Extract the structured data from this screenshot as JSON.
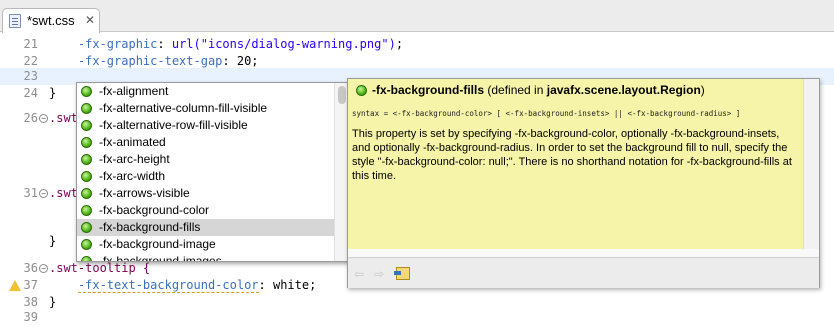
{
  "tab": {
    "title": "*swt.css",
    "close_glyph": "✕",
    "icon": "css-file-icon"
  },
  "editor": {
    "lines": [
      {
        "num": "21",
        "indent": "    ",
        "prop": "-fx-graphic",
        "rest": ": ",
        "str": "url(\"icons/dialog-warning.png\")",
        "tail": ";"
      },
      {
        "num": "22",
        "indent": "    ",
        "prop": "-fx-graphic-text-gap",
        "rest": ": 20;"
      },
      {
        "num": "23",
        "text": ""
      },
      {
        "num": "24",
        "text": "}"
      },
      {
        "num": "26",
        "text": ".swt"
      },
      {
        "num": "31",
        "text": ".swt"
      },
      {
        "num": "",
        "text": "}"
      },
      {
        "num": "36",
        "text": ".swt-tooltip {"
      },
      {
        "num": "37",
        "indent": "    ",
        "prop": "-fx-text-background-color",
        "rest": ": white;"
      },
      {
        "num": "38",
        "text": "}"
      },
      {
        "num": "39",
        "text": ""
      }
    ],
    "fold_glyph": "−"
  },
  "completion": {
    "items": [
      "-fx-alignment",
      "-fx-alternative-column-fill-visible",
      "-fx-alternative-row-fill-visible",
      "-fx-animated",
      "-fx-arc-height",
      "-fx-arc-width",
      "-fx-arrows-visible",
      "-fx-background-color",
      "-fx-background-fills",
      "-fx-background-image",
      "-fx-background-images"
    ],
    "selected_index": 8
  },
  "info": {
    "name": "-fx-background-fills",
    "defined_prefix": "(defined in ",
    "defined_class": "javafx.scene.layout.Region",
    "defined_suffix": ")",
    "syntax": "syntax = <-fx-background-color> [ <-fx-background-insets> || <-fx-background-radius> ]",
    "description": "This property is set by specifying -fx-background-color, optionally -fx-background-insets, and optionally -fx-background-radius. In order to set the background fill to null, specify the style \"-fx-background-color: null;\". There is no shorthand notation for -fx-background-fills at this time.",
    "back_glyph": "⇦",
    "forward_glyph": "⇨"
  },
  "colors": {
    "property": "#3b6fbf",
    "string": "#2a00ff",
    "info_background": "#f6f4a8",
    "selection": "#d6d6d6"
  }
}
